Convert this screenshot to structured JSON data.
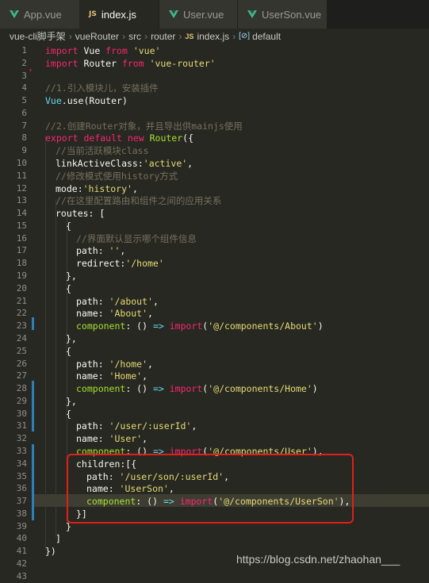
{
  "tabs": [
    {
      "label": "App.vue",
      "icon": "vue-icon"
    },
    {
      "label": "index.js",
      "icon": "js-icon"
    },
    {
      "label": "User.vue",
      "icon": "vue-icon"
    },
    {
      "label": "UserSon.vue",
      "icon": "vue-icon"
    }
  ],
  "breadcrumb": {
    "parts": [
      "vue-cli脚手架",
      "vueRouter",
      "src",
      "router"
    ],
    "file": "index.js",
    "symbol": "default",
    "file_badge": "JS"
  },
  "lines": [
    {
      "n": "1"
    },
    {
      "n": "2"
    },
    {
      "n": "3"
    },
    {
      "n": "4"
    },
    {
      "n": "5"
    },
    {
      "n": "6"
    },
    {
      "n": "7"
    },
    {
      "n": "8"
    },
    {
      "n": "9"
    },
    {
      "n": "10"
    },
    {
      "n": "11"
    },
    {
      "n": "12"
    },
    {
      "n": "13"
    },
    {
      "n": "14"
    },
    {
      "n": "15"
    },
    {
      "n": "16"
    },
    {
      "n": "17"
    },
    {
      "n": "18"
    },
    {
      "n": "19"
    },
    {
      "n": "20"
    },
    {
      "n": "21"
    },
    {
      "n": "22"
    },
    {
      "n": "23"
    },
    {
      "n": "24"
    },
    {
      "n": "25"
    },
    {
      "n": "26"
    },
    {
      "n": "27"
    },
    {
      "n": "28"
    },
    {
      "n": "29"
    },
    {
      "n": "30"
    },
    {
      "n": "31"
    },
    {
      "n": "32"
    },
    {
      "n": "33"
    },
    {
      "n": "34"
    },
    {
      "n": "35"
    },
    {
      "n": "36"
    },
    {
      "n": "37"
    },
    {
      "n": "38"
    },
    {
      "n": "39"
    },
    {
      "n": "40"
    },
    {
      "n": "41"
    },
    {
      "n": "42"
    },
    {
      "n": "43"
    }
  ],
  "code": {
    "l1": [
      "import",
      " Vue ",
      "from",
      " ",
      "'vue'"
    ],
    "l2": [
      "import",
      " Router ",
      "from",
      " ",
      "'vue-router'"
    ],
    "l4": "//1.引入模块儿，安装插件",
    "l5": [
      "Vue",
      ".use(Router)"
    ],
    "l7": "//2.创建Router对象，并且导出供mainjs使用",
    "l8": [
      "export",
      " ",
      "default",
      " ",
      "new",
      " ",
      "Router",
      "({"
    ],
    "l9": "//当前活跃模块class",
    "l10": [
      "linkActiveClass:",
      "'active'",
      ","
    ],
    "l11": "//修改模式使用history方式",
    "l12": [
      "mode:",
      "'history'",
      ","
    ],
    "l13": "//在这里配置路由和组件之间的应用关系",
    "l14": "routes: [",
    "l15": "{",
    "l16": "//界面默认显示哪个组件信息",
    "l17": [
      "path: ",
      "''",
      ","
    ],
    "l18": [
      "redirect:",
      "'/home'"
    ],
    "l19": "},",
    "l20": "{",
    "l21": [
      "path: ",
      "'/about'",
      ","
    ],
    "l22": [
      "name: ",
      "'About'",
      ","
    ],
    "l23": [
      "component",
      ": () ",
      "=>",
      " ",
      "import",
      "(",
      "'@/components/About'",
      ")"
    ],
    "l24": "},",
    "l25": "{",
    "l26": [
      "path: ",
      "'/home'",
      ","
    ],
    "l27": [
      "name: ",
      "'Home'",
      ","
    ],
    "l28": [
      "component",
      ": () ",
      "=>",
      " ",
      "import",
      "(",
      "'@/components/Home'",
      ")"
    ],
    "l29": "},",
    "l30": "{",
    "l31": [
      "path: ",
      "'/user/:userId'",
      ","
    ],
    "l32": [
      "name: ",
      "'User'",
      ","
    ],
    "l33": [
      "component",
      ": () ",
      "=>",
      " ",
      "import",
      "(",
      "'@/components/User'",
      "),"
    ],
    "l34": "children:[{",
    "l35": [
      "path: ",
      "'/user/son/:userId'",
      ","
    ],
    "l36": [
      "name: ",
      "'UserSon'",
      ","
    ],
    "l37": [
      "component",
      ": () ",
      "=>",
      " ",
      "import",
      "(",
      "'@/components/UserSon'",
      "),"
    ],
    "l38": "}]",
    "l39": "}",
    "l40": "]",
    "l41": "})"
  },
  "watermark": "https://blog.csdn.net/zhaohan___",
  "colors": {
    "keyword": "#f92672",
    "string": "#e6db74",
    "comment": "#75715e",
    "function": "#66d9ef",
    "highlight_box": "#e0201a"
  }
}
